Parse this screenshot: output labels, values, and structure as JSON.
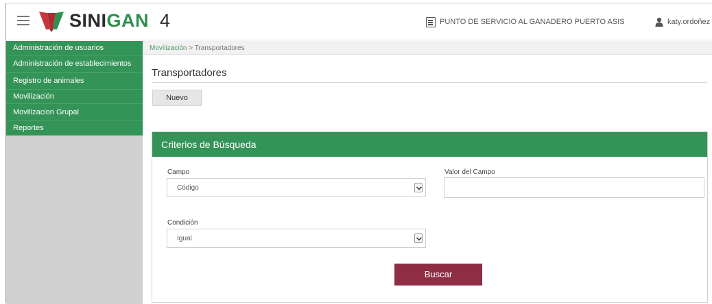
{
  "header": {
    "app_name_part1": "SINI",
    "app_name_part2": "GAN",
    "app_version": "4",
    "service_point": "PUNTO DE SERVICIO AL GANADERO PUERTO ASIS",
    "user": "katy.ordoñez",
    "colors": {
      "brand_green": "#2f8f4e",
      "brand_red": "#c6363b"
    }
  },
  "sidebar": {
    "items": [
      {
        "label": "Administración de usuarios"
      },
      {
        "label": "Administración de establecimientos"
      },
      {
        "label": "Registro de animales"
      },
      {
        "label": "Movilización"
      },
      {
        "label": "Movilizacion Grupal"
      },
      {
        "label": "Reportes"
      }
    ],
    "colors": {
      "menu_bg": "#349357"
    }
  },
  "breadcrumb": {
    "parent": "Movilización",
    "separator": " > ",
    "current": "Transportadores"
  },
  "page": {
    "title": "Transportadores",
    "new_button": "Nuevo"
  },
  "search_panel": {
    "title": "Criterios de Búsqueda",
    "campo_label": "Campo",
    "campo_value": "Código",
    "valor_label": "Valor del Campo",
    "valor_value": "",
    "condicion_label": "Condición",
    "condicion_value": "Igual",
    "search_button": "Buscar",
    "colors": {
      "button": "#8e2d43"
    }
  }
}
